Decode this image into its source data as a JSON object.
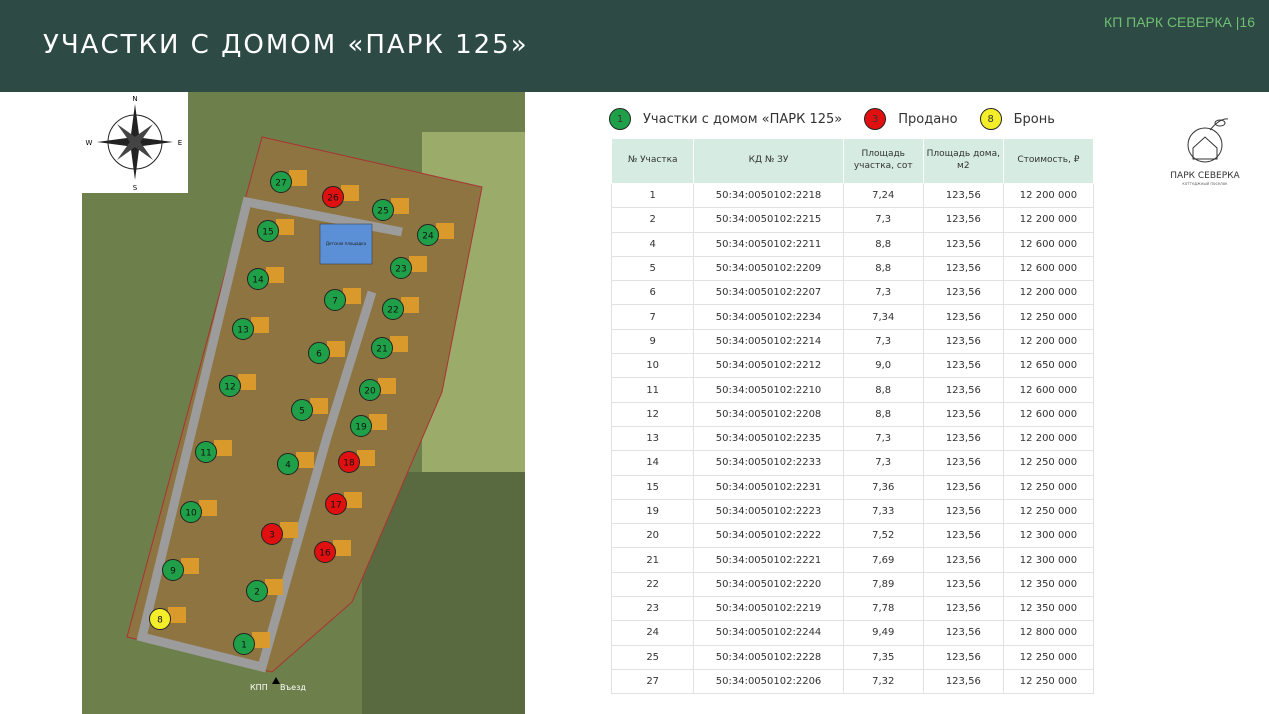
{
  "header": {
    "title": "УЧАСТКИ С ДОМОМ «ПАРК 125»",
    "brand": "КП ПАРК СЕВЕРКА |16"
  },
  "colors": {
    "available": "#1fa048",
    "sold": "#e01010",
    "reserved": "#f4ee2a"
  },
  "legend": [
    {
      "num": "1",
      "label": "Участки с домом «ПАРК 125»",
      "status": "available"
    },
    {
      "num": "3",
      "label": "Продано",
      "status": "sold"
    },
    {
      "num": "8",
      "label": "Бронь",
      "status": "reserved"
    }
  ],
  "logo": {
    "name": "ПАРК СЕВЕРКА",
    "subtitle": "коттеджный поселок"
  },
  "map": {
    "compass": {
      "n": "N",
      "s": "S",
      "e": "E",
      "w": "W"
    },
    "playground": "Детская площадка",
    "checkpoint": "КПП",
    "entrance": "Въезд",
    "plots": [
      {
        "n": "27",
        "s": "available"
      },
      {
        "n": "26",
        "s": "sold"
      },
      {
        "n": "25",
        "s": "available"
      },
      {
        "n": "24",
        "s": "available"
      },
      {
        "n": "15",
        "s": "available"
      },
      {
        "n": "23",
        "s": "available"
      },
      {
        "n": "14",
        "s": "available"
      },
      {
        "n": "7",
        "s": "available"
      },
      {
        "n": "22",
        "s": "available"
      },
      {
        "n": "13",
        "s": "available"
      },
      {
        "n": "6",
        "s": "available"
      },
      {
        "n": "21",
        "s": "available"
      },
      {
        "n": "12",
        "s": "available"
      },
      {
        "n": "20",
        "s": "available"
      },
      {
        "n": "5",
        "s": "available"
      },
      {
        "n": "19",
        "s": "available"
      },
      {
        "n": "11",
        "s": "available"
      },
      {
        "n": "4",
        "s": "available"
      },
      {
        "n": "18",
        "s": "sold"
      },
      {
        "n": "10",
        "s": "available"
      },
      {
        "n": "17",
        "s": "sold"
      },
      {
        "n": "3",
        "s": "sold"
      },
      {
        "n": "16",
        "s": "sold"
      },
      {
        "n": "9",
        "s": "available"
      },
      {
        "n": "2",
        "s": "available"
      },
      {
        "n": "8",
        "s": "reserved"
      },
      {
        "n": "1",
        "s": "available"
      }
    ]
  },
  "table": {
    "headers": [
      "№ Участка",
      "КД № ЗУ",
      "Площадь участка, сот",
      "Площадь дома, м2",
      "Стоимость, ₽"
    ],
    "rows": [
      [
        "1",
        "50:34:0050102:2218",
        "7,24",
        "123,56",
        "12 200 000"
      ],
      [
        "2",
        "50:34:0050102:2215",
        "7,3",
        "123,56",
        "12 200 000"
      ],
      [
        "4",
        "50:34:0050102:2211",
        "8,8",
        "123,56",
        "12 600 000"
      ],
      [
        "5",
        "50:34:0050102:2209",
        "8,8",
        "123,56",
        "12 600 000"
      ],
      [
        "6",
        "50:34:0050102:2207",
        "7,3",
        "123,56",
        "12 200 000"
      ],
      [
        "7",
        "50:34:0050102:2234",
        "7,34",
        "123,56",
        "12 250 000"
      ],
      [
        "9",
        "50:34:0050102:2214",
        "7,3",
        "123,56",
        "12 200 000"
      ],
      [
        "10",
        "50:34:0050102:2212",
        "9,0",
        "123,56",
        "12 650 000"
      ],
      [
        "11",
        "50:34:0050102:2210",
        "8,8",
        "123,56",
        "12 600 000"
      ],
      [
        "12",
        "50:34:0050102:2208",
        "8,8",
        "123,56",
        "12 600 000"
      ],
      [
        "13",
        "50:34:0050102:2235",
        "7,3",
        "123,56",
        "12 200 000"
      ],
      [
        "14",
        "50:34:0050102:2233",
        "7,3",
        "123,56",
        "12 250 000"
      ],
      [
        "15",
        "50:34:0050102:2231",
        "7,36",
        "123,56",
        "12 250 000"
      ],
      [
        "19",
        "50:34:0050102:2223",
        "7,33",
        "123,56",
        "12 250 000"
      ],
      [
        "20",
        "50:34:0050102:2222",
        "7,52",
        "123,56",
        "12 300 000"
      ],
      [
        "21",
        "50:34:0050102:2221",
        "7,69",
        "123,56",
        "12 300 000"
      ],
      [
        "22",
        "50:34:0050102:2220",
        "7,89",
        "123,56",
        "12 350 000"
      ],
      [
        "23",
        "50:34:0050102:2219",
        "7,78",
        "123,56",
        "12 350 000"
      ],
      [
        "24",
        "50:34:0050102:2244",
        "9,49",
        "123,56",
        "12 800 000"
      ],
      [
        "25",
        "50:34:0050102:2228",
        "7,35",
        "123,56",
        "12 250 000"
      ],
      [
        "27",
        "50:34:0050102:2206",
        "7,32",
        "123,56",
        "12 250 000"
      ]
    ]
  }
}
